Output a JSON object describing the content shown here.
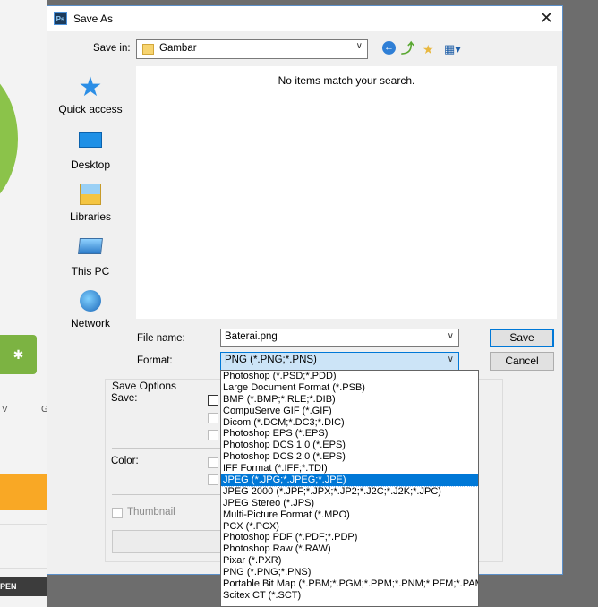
{
  "background": {
    "button_icon": "bluetooth-icon",
    "letter_v": "V",
    "letter_g": "G",
    "pill_label": "PEN"
  },
  "dialog": {
    "title": "Save As",
    "app_icon": "Ps"
  },
  "toolbar": {
    "save_in_label": "Save in:",
    "save_in_value": "Gambar",
    "buttons": [
      "back-icon",
      "up-folder-icon",
      "new-folder-icon",
      "view-menu-icon"
    ]
  },
  "places": [
    {
      "label": "Quick access",
      "icon": "star-icon"
    },
    {
      "label": "Desktop",
      "icon": "desktop-icon"
    },
    {
      "label": "Libraries",
      "icon": "libraries-icon"
    },
    {
      "label": "This PC",
      "icon": "computer-icon"
    },
    {
      "label": "Network",
      "icon": "network-icon"
    }
  ],
  "file_list": {
    "empty_message": "No items match your search."
  },
  "file_name": {
    "label": "File name:",
    "value": "Baterai.png"
  },
  "format": {
    "label": "Format:",
    "value": "PNG (*.PNG;*.PNS)"
  },
  "buttons": {
    "save": "Save",
    "cancel": "Cancel"
  },
  "save_options": {
    "title": "Save Options",
    "save_label": "Save:",
    "color_label": "Color:",
    "thumbnail_label": "Thumbnail"
  },
  "format_options": [
    "Photoshop (*.PSD;*.PDD)",
    "Large Document Format (*.PSB)",
    "BMP (*.BMP;*.RLE;*.DIB)",
    "CompuServe GIF (*.GIF)",
    "Dicom (*.DCM;*.DC3;*.DIC)",
    "Photoshop EPS (*.EPS)",
    "Photoshop DCS 1.0 (*.EPS)",
    "Photoshop DCS 2.0 (*.EPS)",
    "IFF Format (*.IFF;*.TDI)",
    "JPEG (*.JPG;*.JPEG;*.JPE)",
    "JPEG 2000 (*.JPF;*.JPX;*.JP2;*.J2C;*.J2K;*.JPC)",
    "JPEG Stereo (*.JPS)",
    "Multi-Picture Format (*.MPO)",
    "PCX (*.PCX)",
    "Photoshop PDF (*.PDF;*.PDP)",
    "Photoshop Raw (*.RAW)",
    "Pixar (*.PXR)",
    "PNG (*.PNG;*.PNS)",
    "Portable Bit Map (*.PBM;*.PGM;*.PPM;*.PNM;*.PFM;*.PAM)",
    "Scitex CT (*.SCT)"
  ],
  "format_selected": "JPEG (*.JPG;*.JPEG;*.JPE)"
}
